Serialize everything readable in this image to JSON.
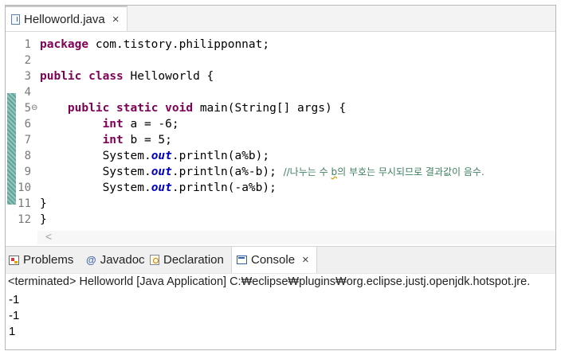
{
  "editor_tab": {
    "title": "Helloworld.java",
    "close": "×",
    "icon": "java-file-icon"
  },
  "code": {
    "line_numbers": [
      "1",
      "2",
      "3",
      "4",
      "5",
      "6",
      "7",
      "8",
      "9",
      "10",
      "11",
      "12"
    ],
    "fold_marker": "⊖",
    "package_kw": "package",
    "package_name": "com.tistory.philipponnat;",
    "public_kw": "public",
    "class_kw": "class",
    "class_name": "Helloworld {",
    "static_kw": "static",
    "void_kw": "void",
    "main_sig": "main(String[] args) {",
    "int_kw": "int",
    "decl_a": "a = -6;",
    "decl_b": "b = 5;",
    "system": "System.",
    "out": "out",
    "println_1": ".println(a%b);",
    "println_2": ".println(a%-b);",
    "println_3": ".println(-a%b);",
    "comment_prefix": "//나누는 수 ",
    "comment_b": "b",
    "comment_rest": "의 부호는 무시되므로 결과값이 음수.",
    "close_brace": "}"
  },
  "views": {
    "tabs": [
      {
        "label": "Problems",
        "icon": "problems-icon"
      },
      {
        "label": "Javadoc",
        "icon": "javadoc-icon"
      },
      {
        "label": "Declaration",
        "icon": "declaration-icon"
      },
      {
        "label": "Console",
        "icon": "console-icon",
        "active": true
      }
    ],
    "javadoc_glyph": "@",
    "close": "×"
  },
  "console": {
    "status": "<terminated> Helloworld [Java Application] C:₩eclipse₩plugins₩org.eclipse.justj.openjdk.hotspot.jre.",
    "output": [
      "-1",
      "-1",
      "1"
    ]
  }
}
